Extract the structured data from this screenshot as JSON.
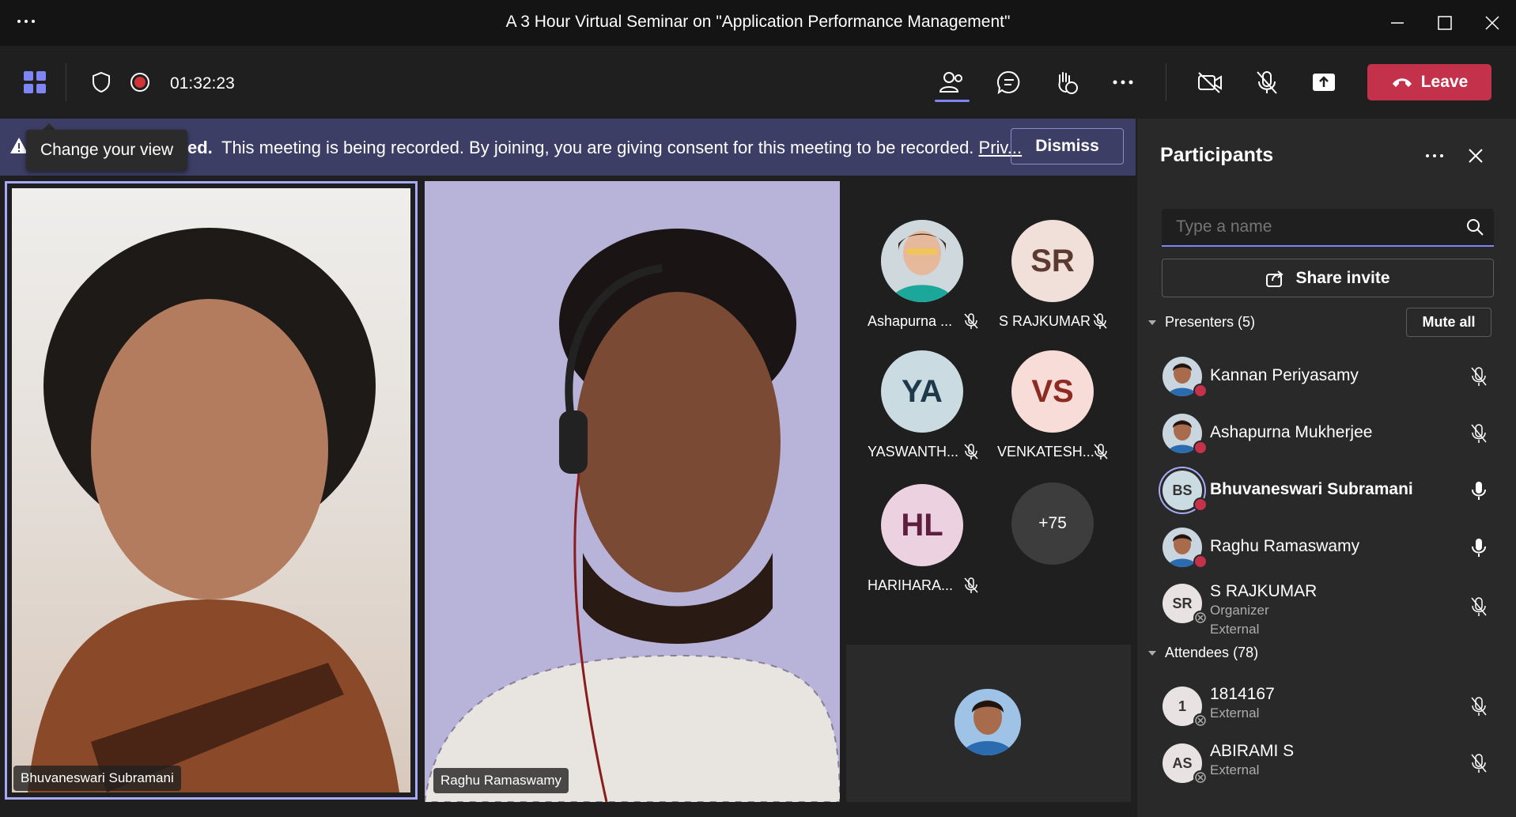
{
  "window": {
    "title": "A 3 Hour Virtual Seminar on \"Application Performance Management\"",
    "menu_icon": "ellipsis-icon"
  },
  "toolbar": {
    "timer": "01:32:23",
    "leave_label": "Leave"
  },
  "tooltip": {
    "text": "Change your view"
  },
  "banner": {
    "prefix": "ed.",
    "message": "This meeting is being recorded. By joining, you are giving consent for this meeting to be recorded.",
    "link": "Priv...",
    "dismiss_label": "Dismiss"
  },
  "videos": [
    {
      "name": "Bhuvaneswari Subramani"
    },
    {
      "name": "Raghu Ramaswamy"
    }
  ],
  "gallery": [
    {
      "initials": "",
      "name": "Ashapurna ...",
      "avatar_bg": "#6fc9c0",
      "photo": true
    },
    {
      "initials": "SR",
      "name": "S RAJKUMAR",
      "avatar_bg": "#f1dfd9",
      "fg": "#5b3a30"
    },
    {
      "initials": "YA",
      "name": "YASWANTH...",
      "avatar_bg": "#cbdbe2",
      "fg": "#1e3a4a"
    },
    {
      "initials": "VS",
      "name": "VENKATESH...",
      "avatar_bg": "#f8dcd8",
      "fg": "#8d2a22"
    },
    {
      "initials": "HL",
      "name": "HARIHARA...",
      "avatar_bg": "#ecd2e0",
      "fg": "#5e1f3f"
    }
  ],
  "overflow_count": "+75",
  "panel": {
    "title": "Participants",
    "search_placeholder": "Type a name",
    "share_label": "Share invite",
    "presenters_label": "Presenters (5)",
    "mute_all_label": "Mute all",
    "attendees_label": "Attendees (78)",
    "presenters": [
      {
        "name": "Kannan Periyasamy",
        "photo": true,
        "mic": "off"
      },
      {
        "name": "Ashapurna Mukherjee",
        "photo": true,
        "mic": "off"
      },
      {
        "name": "Bhuvaneswari Subramani",
        "initials": "BS",
        "mic": "on",
        "bold": true
      },
      {
        "name": "Raghu Ramaswamy",
        "photo": true,
        "mic": "on"
      },
      {
        "name": "S RAJKUMAR",
        "initials": "SR",
        "sub1": "Organizer",
        "sub2": "External",
        "mic": "off"
      }
    ],
    "attendees": [
      {
        "name": "1814167",
        "initials": "1",
        "sub1": "External",
        "mic": "off"
      },
      {
        "name": "ABIRAMI S",
        "initials": "AS",
        "sub1": "External",
        "mic": "off"
      }
    ]
  }
}
